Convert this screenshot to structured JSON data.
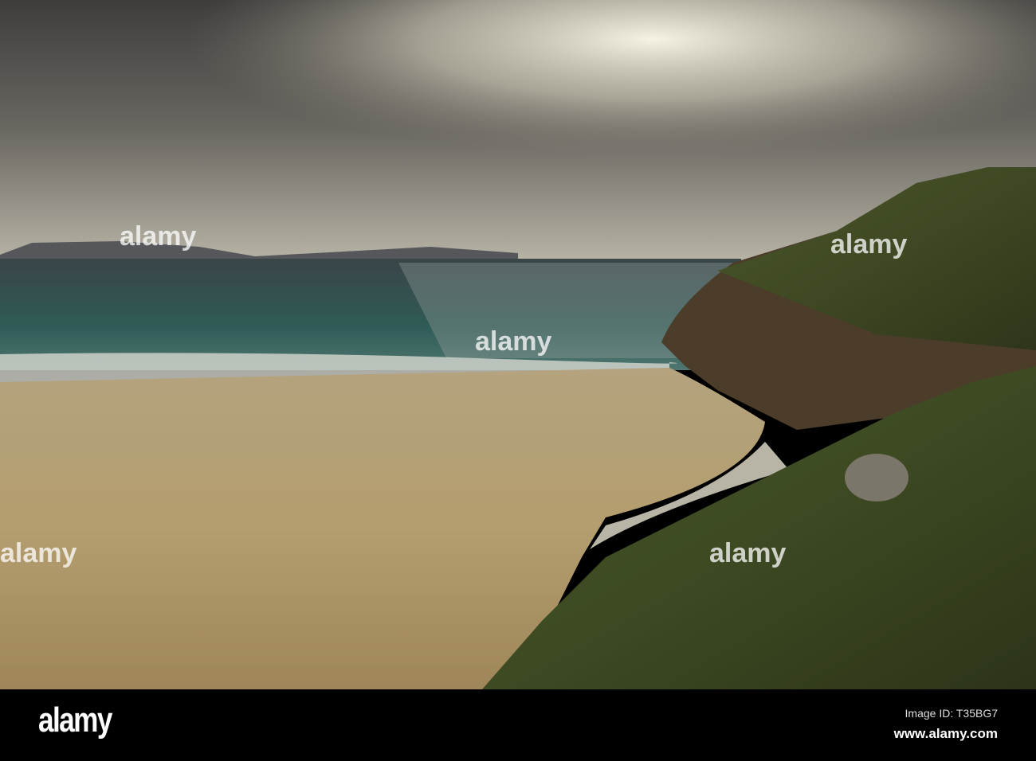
{
  "photo": {
    "subject": "beach-cliff-seascape"
  },
  "watermark": {
    "text": "alamy"
  },
  "footer": {
    "logo": "alamy",
    "image_id": "Image ID: T35BG7",
    "url": "www.alamy.com"
  }
}
